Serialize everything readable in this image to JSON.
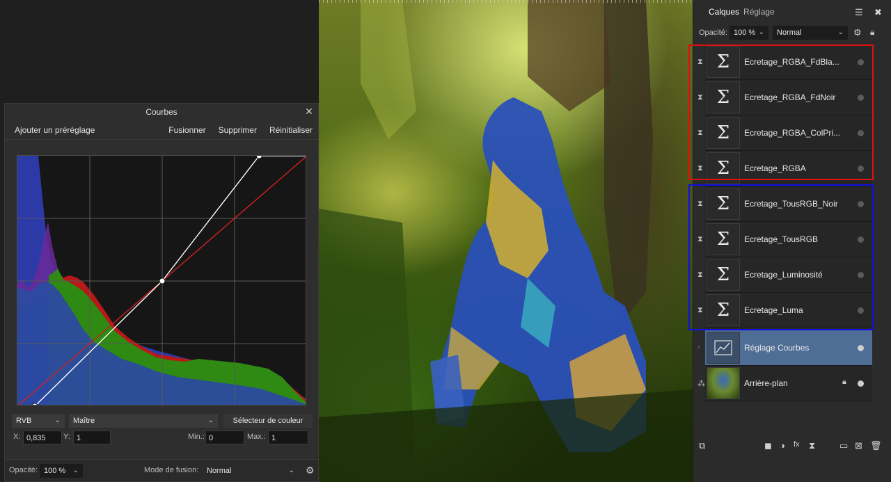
{
  "curves": {
    "title": "Courbes",
    "toolbar": {
      "add_preset": "Ajouter un préréglage",
      "merge": "Fusionner",
      "delete": "Supprimer",
      "reset": "Réinitialiser"
    },
    "channel": "RVB",
    "mode": "Maître",
    "picker": "Sélecteur de couleur",
    "x_label": "X:",
    "x_value": "0,835",
    "y_label": "Y:",
    "y_value": "1",
    "min_label": "Min.:",
    "min_value": "0",
    "max_label": "Max.:",
    "max_value": "1",
    "opacity_label": "Opacité:",
    "opacity_value": "100 %",
    "blend_label": "Mode de fusion:",
    "blend_value": "Normal",
    "curve_points": [
      [
        0.06,
        0.0
      ],
      [
        0.5,
        0.5
      ],
      [
        0.835,
        1.0
      ]
    ]
  },
  "panel": {
    "tabs": [
      "Calques",
      "Réglage"
    ],
    "opacity_label": "Opacité:",
    "opacity_value": "100 %",
    "blend_value": "Normal",
    "layers": [
      {
        "name": "Ecretage_RGBA_FdBla...",
        "icon": "sigma-icon"
      },
      {
        "name": "Ecretage_RGBA_FdNoir",
        "icon": "sigma-icon"
      },
      {
        "name": "Ecretage_RGBA_ColPri...",
        "icon": "sigma-icon"
      },
      {
        "name": "Ecretage_RGBA",
        "icon": "sigma-icon"
      },
      {
        "name": "Ecretage_TousRGB_Noir",
        "icon": "sigma-icon"
      },
      {
        "name": "Ecretage_TousRGB",
        "icon": "sigma-icon"
      },
      {
        "name": "Ecretage_Luminosité",
        "icon": "sigma-icon"
      },
      {
        "name": "Ecretage_Luma",
        "icon": "sigma-icon"
      },
      {
        "name": "Réglage Courbes",
        "icon": "curves-icon",
        "selected": true
      },
      {
        "name": "Arrière-plan",
        "icon": "image-thumbnail",
        "locked": true
      }
    ]
  },
  "colors": {
    "selected_layer": "#4f6e96",
    "highlight_red": "#e01010",
    "highlight_blue": "#1010e0"
  }
}
